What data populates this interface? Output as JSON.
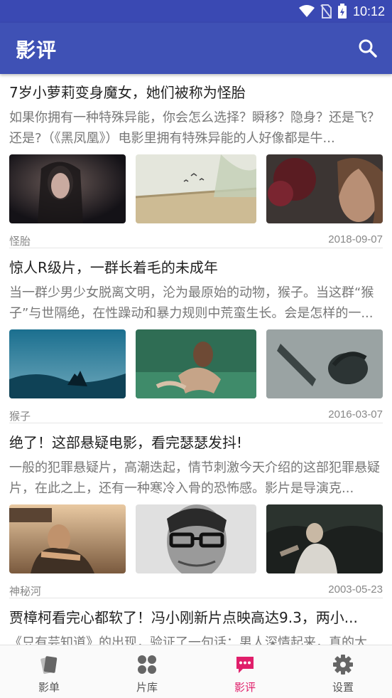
{
  "status": {
    "time": "10:12"
  },
  "app": {
    "title": "影评"
  },
  "articles": [
    {
      "title": "7岁小萝莉变身魔女，她们被称为怪胎",
      "summary": "如果你拥有一种特殊异能，你会怎么选择？瞬移？隐身？还是飞？还是?（《黑凤凰》）电影里拥有特殊异能的人好像都是牛...",
      "tag": "怪胎",
      "date": "2018-09-07"
    },
    {
      "title": "惊人R级片，一群长着毛的未成年",
      "summary": "当一群少男少女脱离文明，沦为最原始的动物，猴子。当这群“猴子”与世隔绝，在性躁动和暴力规则中荒蛮生长。会是怎样的一...",
      "tag": "猴子",
      "date": "2016-03-07"
    },
    {
      "title": "绝了！这部悬疑电影，看完瑟瑟发抖!",
      "summary": "一般的犯罪悬疑片，高潮迭起，情节刺激今天介绍的这部犯罪悬疑片，在此之上，还有一种寒冷入骨的恐怖感。影片是导演克...",
      "tag": "神秘河",
      "date": "2003-05-23"
    },
    {
      "title": "贾樟柯看完心都软了！冯小刚新片点映高达9.3，两小...",
      "summary": "《只有芸知道》的出现，验证了一句话：男人深情起来，真的太..."
    }
  ],
  "nav": [
    {
      "label": "影单",
      "icon": "cards-icon",
      "active": false
    },
    {
      "label": "片库",
      "icon": "grid-icon",
      "active": false
    },
    {
      "label": "影评",
      "icon": "chat-icon",
      "active": true
    },
    {
      "label": "设置",
      "icon": "gear-icon",
      "active": false
    }
  ],
  "colors": {
    "primary": "#3f51b5",
    "status_bar": "#3a49b3",
    "accent": "#e01e6a"
  }
}
